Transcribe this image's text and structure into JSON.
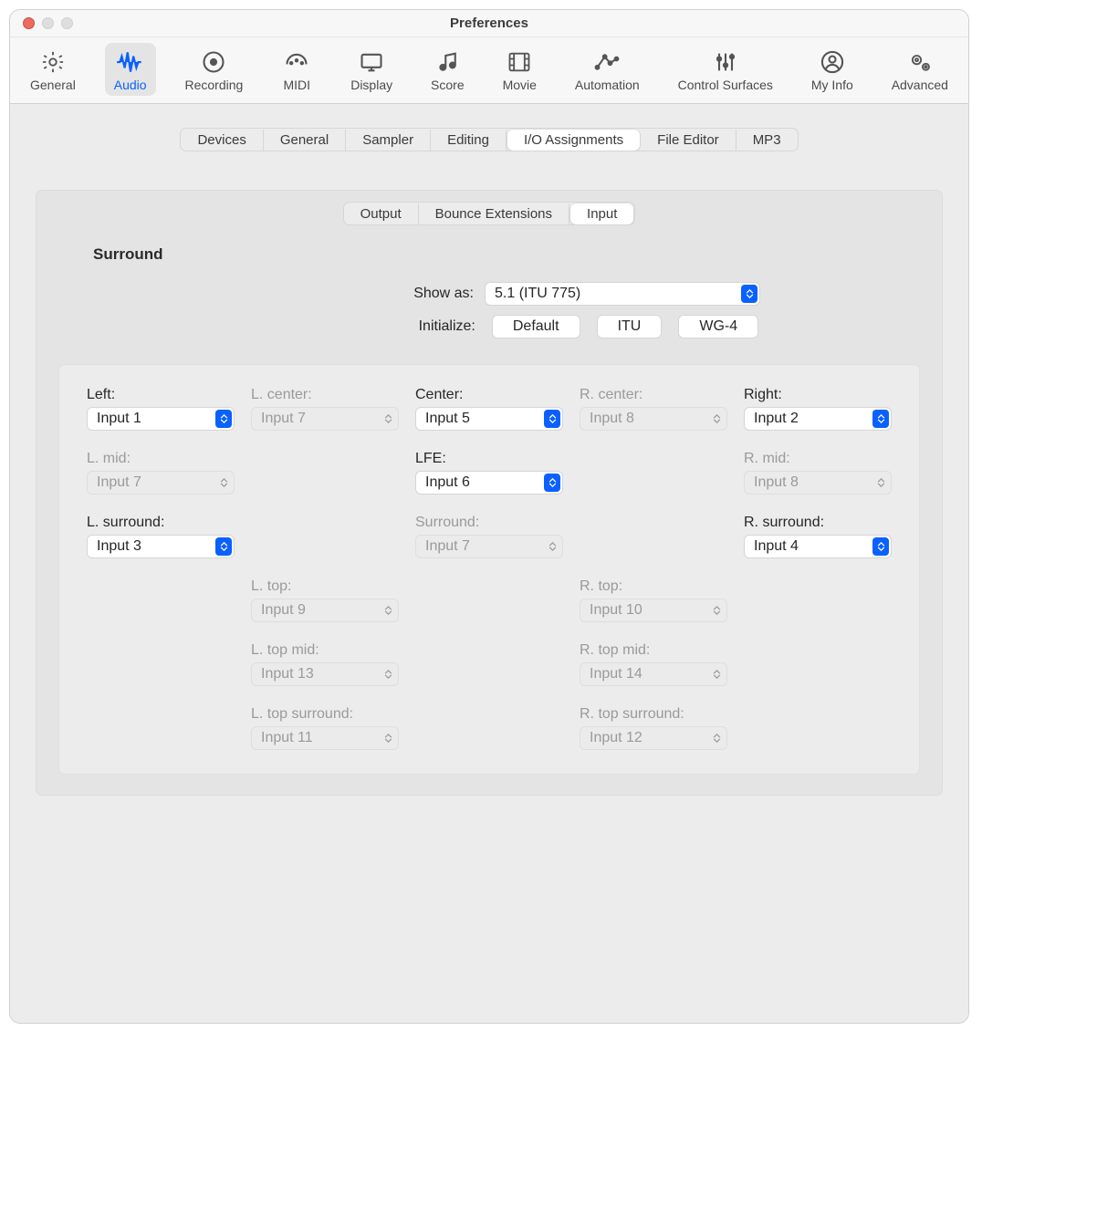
{
  "window": {
    "title": "Preferences"
  },
  "toolbar": [
    {
      "id": "general",
      "label": "General"
    },
    {
      "id": "audio",
      "label": "Audio",
      "selected": true
    },
    {
      "id": "recording",
      "label": "Recording"
    },
    {
      "id": "midi",
      "label": "MIDI"
    },
    {
      "id": "display",
      "label": "Display"
    },
    {
      "id": "score",
      "label": "Score"
    },
    {
      "id": "movie",
      "label": "Movie"
    },
    {
      "id": "automation",
      "label": "Automation"
    },
    {
      "id": "controlsurfaces",
      "label": "Control Surfaces"
    },
    {
      "id": "myinfo",
      "label": "My Info"
    },
    {
      "id": "advanced",
      "label": "Advanced"
    }
  ],
  "tabs1": [
    {
      "label": "Devices"
    },
    {
      "label": "General"
    },
    {
      "label": "Sampler"
    },
    {
      "label": "Editing"
    },
    {
      "label": "I/O Assignments",
      "selected": true
    },
    {
      "label": "File Editor"
    },
    {
      "label": "MP3"
    }
  ],
  "tabs2": [
    {
      "label": "Output"
    },
    {
      "label": "Bounce Extensions"
    },
    {
      "label": "Input",
      "selected": true
    }
  ],
  "surround": {
    "heading": "Surround",
    "showas_label": "Show as:",
    "showas_value": "5.1 (ITU 775)",
    "init_label": "Initialize:",
    "init_buttons": [
      "Default",
      "ITU",
      "WG-4"
    ],
    "channels": {
      "left": {
        "label": "Left:",
        "value": "Input 1",
        "enabled": true
      },
      "lcenter": {
        "label": "L. center:",
        "value": "Input 7",
        "enabled": false
      },
      "center": {
        "label": "Center:",
        "value": "Input 5",
        "enabled": true
      },
      "rcenter": {
        "label": "R. center:",
        "value": "Input 8",
        "enabled": false
      },
      "right": {
        "label": "Right:",
        "value": "Input 2",
        "enabled": true
      },
      "lmid": {
        "label": "L. mid:",
        "value": "Input 7",
        "enabled": false
      },
      "lfe": {
        "label": "LFE:",
        "value": "Input 6",
        "enabled": true
      },
      "rmid": {
        "label": "R. mid:",
        "value": "Input 8",
        "enabled": false
      },
      "lsurr": {
        "label": "L. surround:",
        "value": "Input 3",
        "enabled": true
      },
      "surr": {
        "label": "Surround:",
        "value": "Input 7",
        "enabled": false
      },
      "rsurr": {
        "label": "R. surround:",
        "value": "Input 4",
        "enabled": true
      },
      "ltop": {
        "label": "L. top:",
        "value": "Input 9",
        "enabled": false
      },
      "rtop": {
        "label": "R. top:",
        "value": "Input 10",
        "enabled": false
      },
      "ltopmid": {
        "label": "L. top mid:",
        "value": "Input 13",
        "enabled": false
      },
      "rtopmid": {
        "label": "R. top mid:",
        "value": "Input 14",
        "enabled": false
      },
      "ltopsurr": {
        "label": "L. top surround:",
        "value": "Input 11",
        "enabled": false
      },
      "rtopsurr": {
        "label": "R. top surround:",
        "value": "Input 12",
        "enabled": false
      }
    }
  }
}
